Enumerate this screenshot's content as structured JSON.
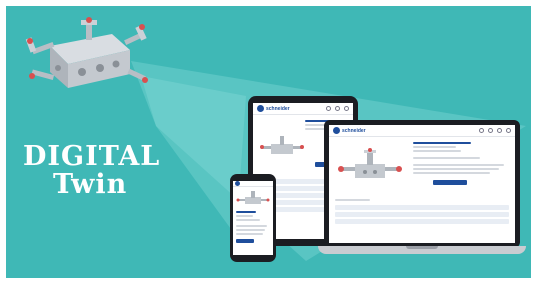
{
  "headline": {
    "line1": "DIGITAL",
    "line2": "Twin"
  },
  "colors": {
    "background": "#3fb8b6",
    "device_frame": "#1b1d22",
    "brand_blue": "#1f4e9c",
    "headline_text": "#ffffff"
  },
  "devices": {
    "brand": "schneider",
    "icons": [
      "product-image-icon",
      "valve-manifold-icon"
    ]
  }
}
